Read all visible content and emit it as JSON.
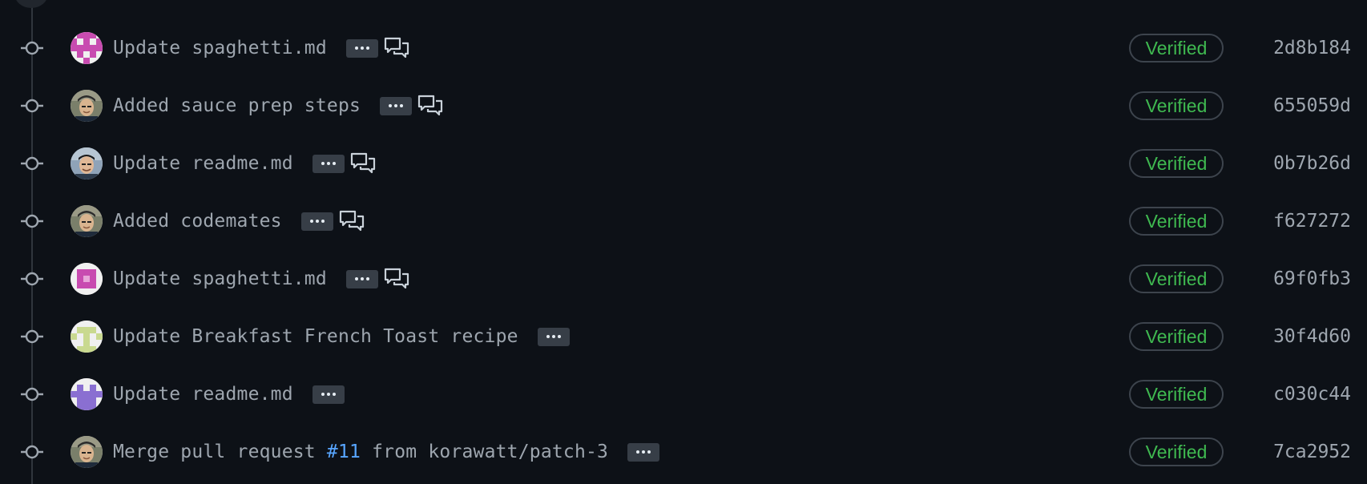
{
  "commits": [
    {
      "message": "Update spaghetti.md",
      "pr_number": "",
      "message_suffix": "",
      "avatar": "identicon-pink-1",
      "has_comment": true,
      "verified_label": "Verified",
      "sha": "2d8b184"
    },
    {
      "message": "Added sauce prep steps",
      "pr_number": "",
      "message_suffix": "",
      "avatar": "photo-user-1",
      "has_comment": true,
      "verified_label": "Verified",
      "sha": "655059d"
    },
    {
      "message": "Update readme.md",
      "pr_number": "",
      "message_suffix": "",
      "avatar": "photo-user-2",
      "has_comment": true,
      "verified_label": "Verified",
      "sha": "0b7b26d"
    },
    {
      "message": "Added codemates",
      "pr_number": "",
      "message_suffix": "",
      "avatar": "photo-user-1",
      "has_comment": true,
      "verified_label": "Verified",
      "sha": "f627272"
    },
    {
      "message": "Update spaghetti.md",
      "pr_number": "",
      "message_suffix": "",
      "avatar": "identicon-pink-2",
      "has_comment": true,
      "verified_label": "Verified",
      "sha": "69f0fb3"
    },
    {
      "message": "Update Breakfast French Toast recipe",
      "pr_number": "",
      "message_suffix": "",
      "avatar": "identicon-green",
      "has_comment": false,
      "verified_label": "Verified",
      "sha": "30f4d60"
    },
    {
      "message": "Update readme.md",
      "pr_number": "",
      "message_suffix": "",
      "avatar": "identicon-purple",
      "has_comment": false,
      "verified_label": "Verified",
      "sha": "c030c44"
    },
    {
      "message": "Merge pull request ",
      "pr_number": "#11",
      "message_suffix": " from korawatt/patch-3",
      "avatar": "photo-user-1",
      "has_comment": false,
      "verified_label": "Verified",
      "sha": "7ca2952"
    }
  ],
  "colors": {
    "background": "#0d1117",
    "timeline": "#30363d",
    "text": "#9ea6af",
    "verified": "#3fb950",
    "link": "#58a6ff"
  },
  "icons": {
    "node": "git-commit-icon",
    "comment": "comment-discussion-icon",
    "ellipsis": "ellipsis-icon"
  }
}
